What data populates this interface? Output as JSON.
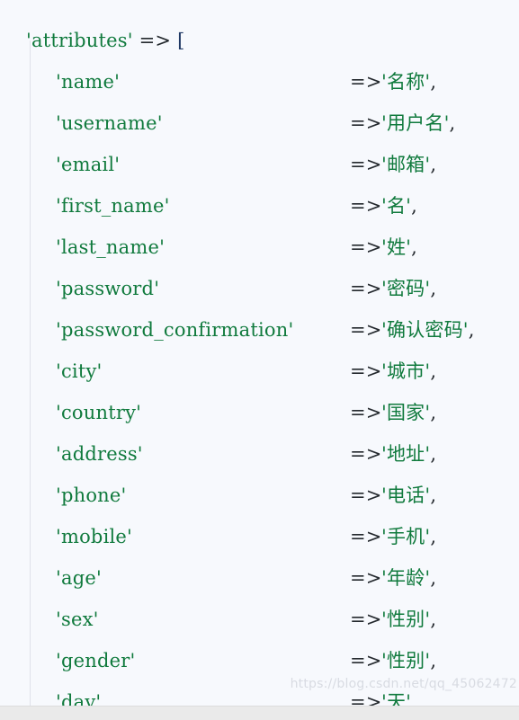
{
  "code_block": {
    "language": "php",
    "header_line": {
      "key_quoted": "'attributes'",
      "arrow": "=>",
      "open_bracket": "["
    },
    "arrow_symbol": "=>",
    "comma_symbol": ",",
    "entries": [
      {
        "key": "'name'",
        "arrow": "=>",
        "value": "'名称'",
        "comma": ","
      },
      {
        "key": "'username'",
        "arrow": "=>",
        "value": "'用户名'",
        "comma": ","
      },
      {
        "key": "'email'",
        "arrow": "=>",
        "value": "'邮箱'",
        "comma": ","
      },
      {
        "key": "'first_name'",
        "arrow": "=>",
        "value": "'名'",
        "comma": ","
      },
      {
        "key": "'last_name'",
        "arrow": "=>",
        "value": "'姓'",
        "comma": ","
      },
      {
        "key": "'password'",
        "arrow": "=>",
        "value": "'密码'",
        "comma": ","
      },
      {
        "key": "'password_confirmation'",
        "arrow": "=>",
        "value": "'确认密码'",
        "comma": ","
      },
      {
        "key": "'city'",
        "arrow": "=>",
        "value": "'城市'",
        "comma": ","
      },
      {
        "key": "'country'",
        "arrow": "=>",
        "value": "'国家'",
        "comma": ","
      },
      {
        "key": "'address'",
        "arrow": "=>",
        "value": "'地址'",
        "comma": ","
      },
      {
        "key": "'phone'",
        "arrow": "=>",
        "value": "'电话'",
        "comma": ","
      },
      {
        "key": "'mobile'",
        "arrow": "=>",
        "value": "'手机'",
        "comma": ","
      },
      {
        "key": "'age'",
        "arrow": "=>",
        "value": "'年龄'",
        "comma": ","
      },
      {
        "key": "'sex'",
        "arrow": "=>",
        "value": "'性别'",
        "comma": ","
      },
      {
        "key": "'gender'",
        "arrow": "=>",
        "value": "'性别'",
        "comma": ","
      },
      {
        "key": "'day'",
        "arrow": "=>",
        "value": "'天'",
        "comma": ","
      }
    ]
  },
  "watermark": {
    "text": "https://blog.csdn.net/qq_45062472"
  },
  "colors": {
    "background": "#f7f9fd",
    "string_green": "#107a3d",
    "punctuation": "#24292e",
    "bracket_navy": "#1f3864",
    "indent_guide": "#dfe1ea",
    "footer_band": "#eaeaea",
    "watermark": "#d8dbe2"
  }
}
